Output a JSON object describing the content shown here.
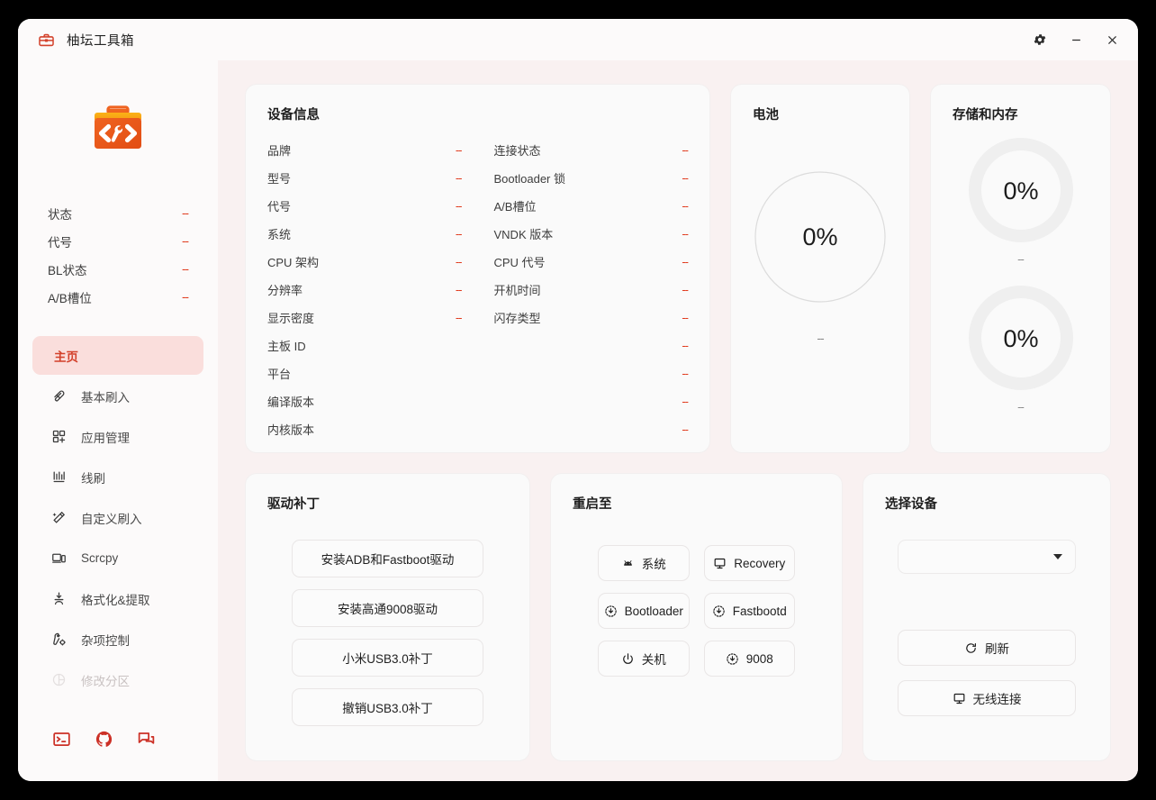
{
  "window": {
    "title": "柚坛工具箱",
    "icon": "toolbox-icon",
    "controls": {
      "settings": "gear-icon",
      "minimize": "minimize-icon",
      "close": "close-icon"
    },
    "accent": "#d3412b",
    "dash": "--"
  },
  "sidebar": {
    "logo": "toolbox-logo",
    "status": [
      {
        "label": "状态",
        "value": "--"
      },
      {
        "label": "代号",
        "value": "--"
      },
      {
        "label": "BL状态",
        "value": "--"
      },
      {
        "label": "A/B槽位",
        "value": "--"
      }
    ],
    "nav": [
      {
        "label": "主页",
        "icon": "",
        "active": true,
        "disabled": false
      },
      {
        "label": "基本刷入",
        "icon": "flash-icon",
        "active": false,
        "disabled": false
      },
      {
        "label": "应用管理",
        "icon": "apps-add-icon",
        "active": false,
        "disabled": false
      },
      {
        "label": "线刷",
        "icon": "chart-flash-icon",
        "active": false,
        "disabled": false
      },
      {
        "label": "自定义刷入",
        "icon": "magic-wand-icon",
        "active": false,
        "disabled": false
      },
      {
        "label": "Scrcpy",
        "icon": "device-screen-icon",
        "active": false,
        "disabled": false
      },
      {
        "label": "格式化&提取",
        "icon": "extract-icon",
        "active": false,
        "disabled": false
      },
      {
        "label": "杂项控制",
        "icon": "wrench-gear-icon",
        "active": false,
        "disabled": false
      },
      {
        "label": "修改分区",
        "icon": "pie-partition-icon",
        "active": false,
        "disabled": true
      }
    ],
    "footer": [
      {
        "name": "terminal-icon"
      },
      {
        "name": "github-icon"
      },
      {
        "name": "chat-icon"
      }
    ]
  },
  "device_info": {
    "title": "设备信息",
    "left": [
      {
        "label": "品牌",
        "value": "--"
      },
      {
        "label": "型号",
        "value": "--"
      },
      {
        "label": "代号",
        "value": "--"
      },
      {
        "label": "系统",
        "value": "--"
      },
      {
        "label": "CPU 架构",
        "value": "--"
      },
      {
        "label": "分辨率",
        "value": "--"
      },
      {
        "label": "显示密度",
        "value": "--"
      }
    ],
    "right": [
      {
        "label": "连接状态",
        "value": "--"
      },
      {
        "label": "Bootloader 锁",
        "value": "--"
      },
      {
        "label": "A/B槽位",
        "value": "--"
      },
      {
        "label": "VNDK 版本",
        "value": "--"
      },
      {
        "label": "CPU 代号",
        "value": "--"
      },
      {
        "label": "开机时间",
        "value": "--"
      },
      {
        "label": "闪存类型",
        "value": "--"
      }
    ],
    "full": [
      {
        "label": "主板 ID",
        "value": "--"
      },
      {
        "label": "平台",
        "value": "--"
      },
      {
        "label": "编译版本",
        "value": "--"
      },
      {
        "label": "内核版本",
        "value": "--"
      }
    ]
  },
  "battery": {
    "title": "电池",
    "percent": "0%",
    "percent_value": 0,
    "detail": "--"
  },
  "storage": {
    "title": "存储和内存",
    "gauges": [
      {
        "percent": "0%",
        "percent_value": 0,
        "detail": "--"
      },
      {
        "percent": "0%",
        "percent_value": 0,
        "detail": "--"
      }
    ]
  },
  "driver": {
    "title": "驱动补丁",
    "buttons": [
      {
        "label": "安装ADB和Fastboot驱动"
      },
      {
        "label": "安装高通9008驱动"
      },
      {
        "label": "小米USB3.0补丁"
      },
      {
        "label": "撤销USB3.0补丁"
      }
    ]
  },
  "reboot": {
    "title": "重启至",
    "buttons": [
      {
        "label": "系统",
        "icon": "android-icon"
      },
      {
        "label": "Recovery",
        "icon": "monitor-icon"
      },
      {
        "label": "Bootloader",
        "icon": "download-circle-icon"
      },
      {
        "label": "Fastbootd",
        "icon": "download-circle-icon"
      },
      {
        "label": "关机",
        "icon": "power-icon"
      },
      {
        "label": "9008",
        "icon": "download-circle-icon"
      }
    ]
  },
  "select_device": {
    "title": "选择设备",
    "dropdown_value": "",
    "dropdown_icon": "chevron-down-icon",
    "refresh_label": "刷新",
    "refresh_icon": "refresh-icon",
    "wireless_label": "无线连接",
    "wireless_icon": "monitor-icon"
  }
}
